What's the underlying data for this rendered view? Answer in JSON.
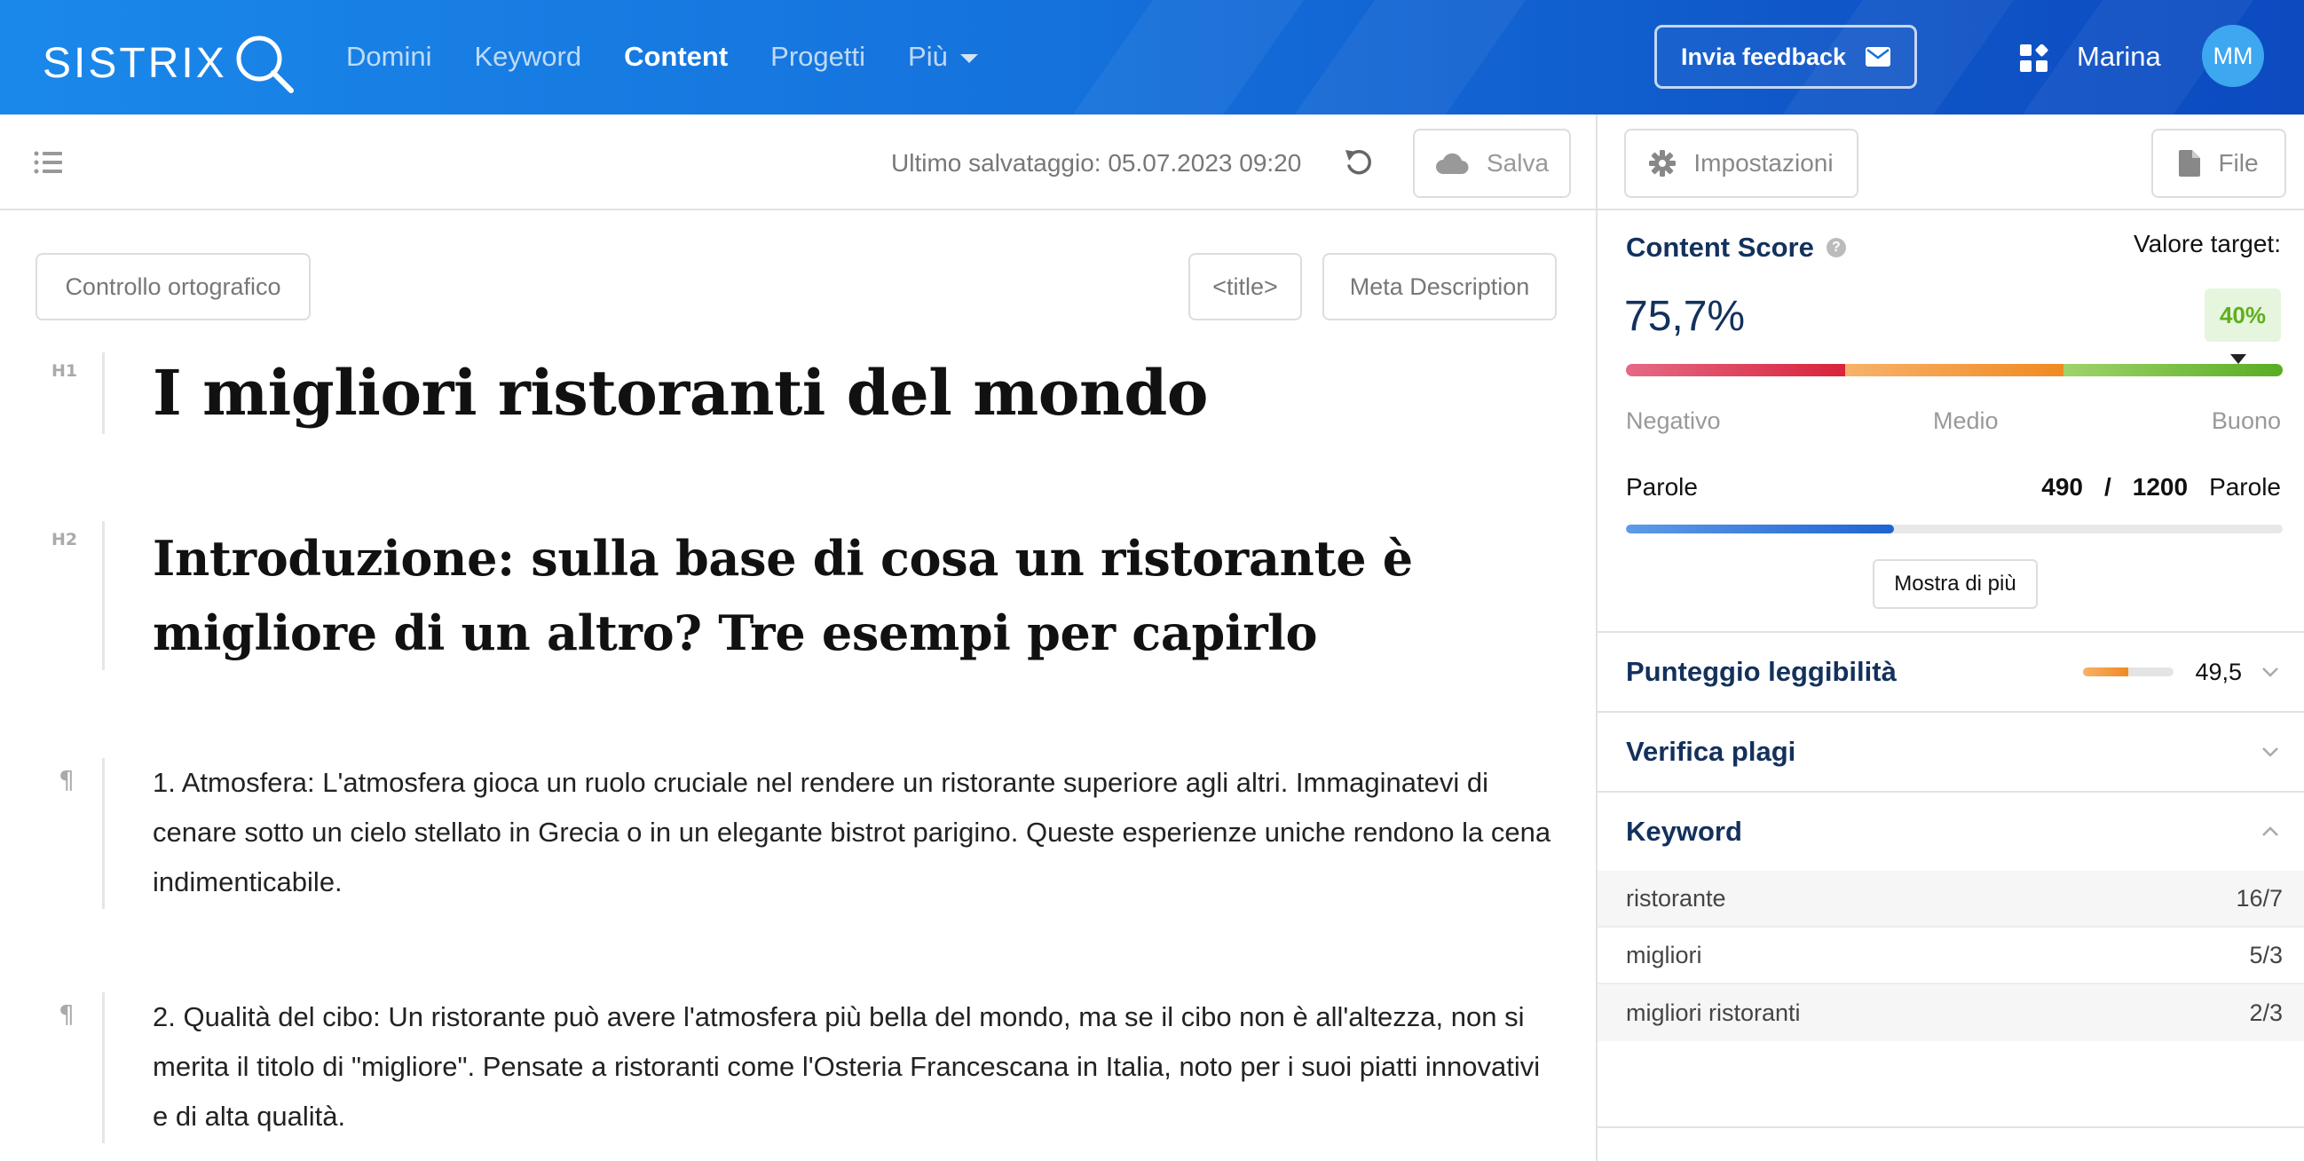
{
  "header": {
    "logo": "SISTRIX",
    "nav": [
      {
        "label": "Domini"
      },
      {
        "label": "Keyword"
      },
      {
        "label": "Content"
      },
      {
        "label": "Progetti"
      },
      {
        "label": "Più"
      }
    ],
    "active_nav": "Content",
    "feedback_label": "Invia feedback",
    "user_name": "Marina",
    "avatar_initials": "MM"
  },
  "toolbar": {
    "save_status": "Ultimo salvataggio: 05.07.2023 09:20",
    "save_label": "Salva"
  },
  "editor": {
    "spellcheck_label": "Controllo ortografico",
    "title_chip": "<title>",
    "meta_chip": "Meta Description",
    "blocks": [
      {
        "tag": "H1",
        "text": "I migliori ristoranti del mondo"
      },
      {
        "tag": "H2",
        "text": "Introduzione: sulla base di cosa un ristorante è migliore di un altro? Tre esempi per capirlo"
      },
      {
        "tag": "¶",
        "text": "1. Atmosfera: L'atmosfera gioca un ruolo cruciale nel rendere un ristorante superiore agli altri. Immaginatevi di cenare sotto un cielo stellato in Grecia o in un elegante bistrot parigino. Queste esperienze uniche rendono la cena indimenticabile."
      },
      {
        "tag": "¶",
        "text": "2. Qualità del cibo: Un ristorante può avere l'atmosfera più bella del mondo, ma se il cibo non è all'altezza, non si merita il titolo di \"migliore\". Pensate a ristoranti come l'Osteria Francescana in Italia, noto per i suoi piatti innovativi e di alta qualità."
      }
    ]
  },
  "panel": {
    "settings_label": "Impostazioni",
    "file_label": "File",
    "content_score_label": "Content Score",
    "target_label": "Valore target:",
    "content_score_value": "75,7%",
    "target_value": "40%",
    "score_fraction": 0.932,
    "scale_labels": {
      "negative": "Negativo",
      "medium": "Medio",
      "good": "Buono"
    },
    "words_label": "Parole",
    "words_current": "490",
    "words_separator": "/",
    "words_target": "1200",
    "words_unit": "Parole",
    "words_fraction": 0.4083,
    "show_more_label": "Mostra di più",
    "readability_label": "Punteggio leggibilità",
    "readability_value": "49,5",
    "readability_fraction": 0.5,
    "plagiarism_label": "Verifica plagi",
    "keyword_label": "Keyword",
    "keywords": [
      {
        "term": "ristorante",
        "count": "16/7"
      },
      {
        "term": "migliori",
        "count": "5/3"
      },
      {
        "term": "migliori ristoranti",
        "count": "2/3"
      }
    ]
  },
  "icons": {
    "outline": "list-icon",
    "undo": "undo-icon",
    "save": "cloud-icon",
    "settings": "gear-icon",
    "file": "file-icon",
    "feedback": "envelope-icon",
    "apps": "apps-grid-icon",
    "logo": "magnifier-icon"
  },
  "colors": {
    "brand_blue": "#1a88ea",
    "navy_text": "#13315c",
    "good_green": "#59ad22",
    "medium_orange": "#f08a22",
    "negative_red": "#d8233b",
    "progress_blue": "#1f64d2"
  }
}
